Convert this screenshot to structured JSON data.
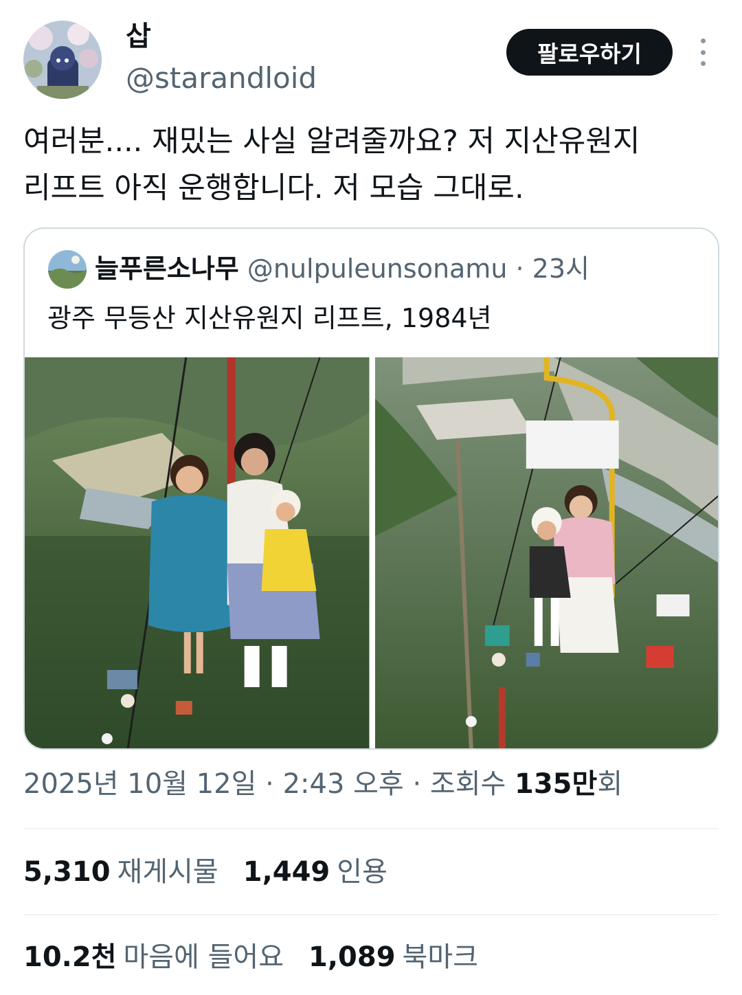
{
  "author": {
    "display_name": "삽",
    "handle": "@starandloid"
  },
  "follow_label": "팔로우하기",
  "tweet_text": "여러분.... 재밌는 사실 알려줄까요? 저 지산유원지\n리프트 아직 운행합니다. 저 모습 그대로.",
  "quote": {
    "display_name": "늘푸른소나무",
    "handle": "@nulpuleunsonamu",
    "separator": " · ",
    "time": "23시",
    "text": "광주 무등산 지산유원지 리프트, 1984년"
  },
  "timestamp": {
    "date": "2025년 10월 12일",
    "sep1": " · ",
    "time": "2:43 오후",
    "sep2": " · ",
    "views_label": "조회수 ",
    "views_number": "135만",
    "views_suffix": "회"
  },
  "stats": {
    "retweets": {
      "value": "5,310",
      "label": "재게시물"
    },
    "quotes": {
      "value": "1,449",
      "label": "인용"
    },
    "likes": {
      "value": "10.2천",
      "label": "마음에 들어요"
    },
    "bookmarks": {
      "value": "1,089",
      "label": "북마크"
    }
  },
  "icons": {
    "more": "more-vertical-icon"
  },
  "colors": {
    "text_primary": "#0f1419",
    "text_secondary": "#536471",
    "border": "#cfd9de",
    "button_bg": "#0f1419"
  }
}
